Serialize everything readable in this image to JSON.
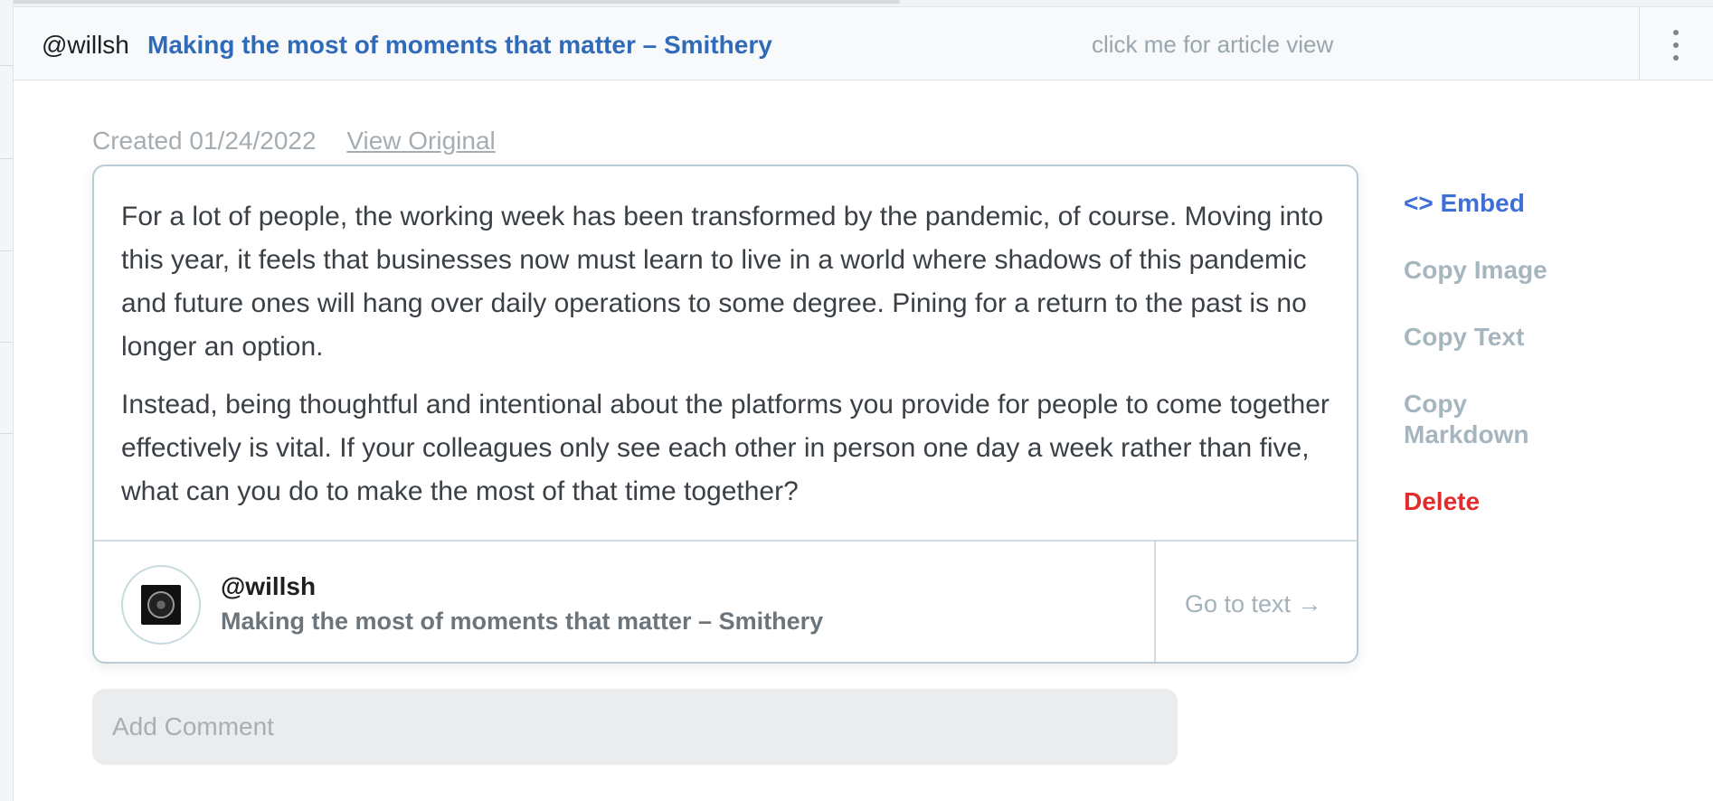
{
  "header": {
    "handle": "@willsh",
    "title": "Making the most of moments that matter – Smithery",
    "article_view_label": "click me for article view",
    "menu_icon": "kebab-vertical-icon"
  },
  "meta": {
    "created": "Created 01/24/2022",
    "view_original": "View Original"
  },
  "card": {
    "paragraphs": [
      "For a lot of people, the working week has been transformed by the pandemic, of course. Moving into this year, it feels that businesses now must learn to live in a world where shadows of this pandemic and future ones will hang over daily operations to some degree. Pining for a return to the past is no longer an option.",
      "Instead, being thoughtful and intentional about the platforms you provide for people to come together effectively is vital. If your colleagues only see each other in person one day a week rather than five, what can you do to make the most of that time together?"
    ],
    "footer": {
      "handle": "@willsh",
      "title": "Making the most of moments that matter – Smithery",
      "go_to_text": "Go to text →"
    }
  },
  "actions": {
    "embed": "<> Embed",
    "copy_image": "Copy Image",
    "copy_text": "Copy Text",
    "copy_markdown": "Copy Markdown",
    "delete": "Delete"
  },
  "comment": {
    "placeholder": "Add Comment"
  },
  "colors": {
    "link_blue": "#2f6bb8",
    "embed_blue": "#3f6fd6",
    "delete_red": "#e02d2d",
    "muted_action": "#a6b6be"
  }
}
